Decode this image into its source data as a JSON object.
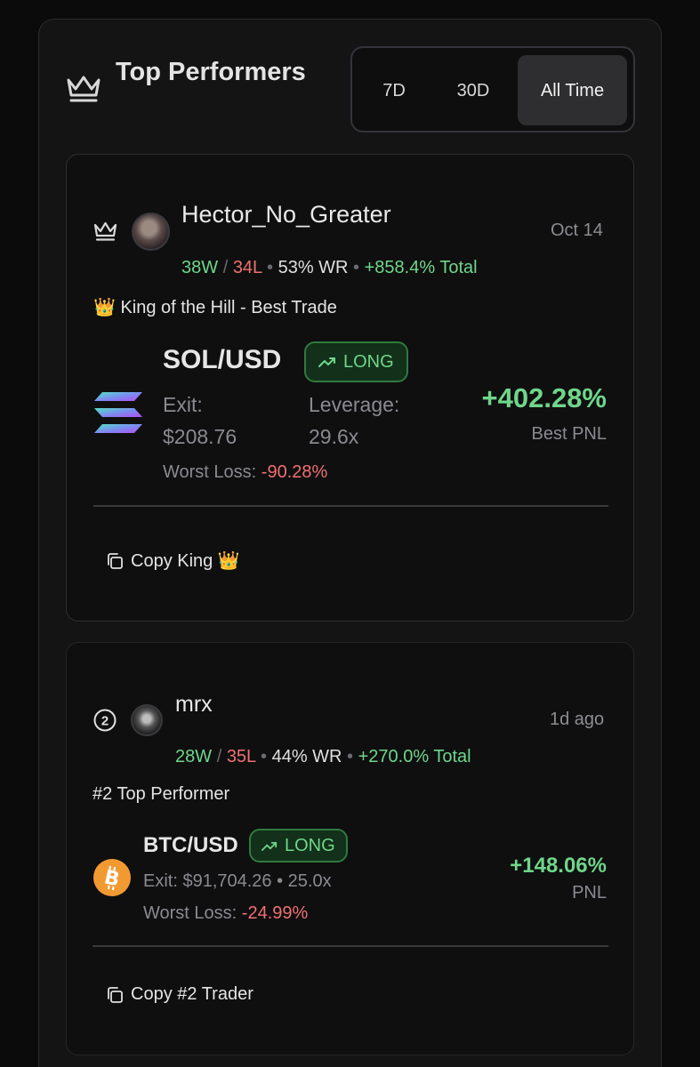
{
  "header": {
    "title": "Top Performers",
    "ranges": [
      "7D",
      "30D",
      "All Time"
    ],
    "selected_range": "All Time"
  },
  "cards": [
    {
      "rank_icon": "crown-icon",
      "name": "Hector_No_Greater",
      "date": "Oct 14",
      "wins": "38W",
      "losses": "34L",
      "win_rate": "53% WR",
      "total": "+858.4% Total",
      "tagline": "👑 King of the Hill - Best Trade",
      "pair": "SOL/USD",
      "side": "LONG",
      "exit_label": "Exit:",
      "exit_value": "$208.76",
      "leverage_label": "Leverage:",
      "leverage_value": "29.6x",
      "worst_loss_label": "Worst Loss:",
      "worst_loss_value": "-90.28%",
      "pnl": "+402.28%",
      "pnl_label": "Best PNL",
      "copy_label": "Copy King 👑"
    },
    {
      "rank_icon": "rank-2-icon",
      "rank_text": "2",
      "name": "mrx",
      "date": "1d ago",
      "wins": "28W",
      "losses": "35L",
      "win_rate": "44% WR",
      "total": "+270.0% Total",
      "tagline": "#2 Top Performer",
      "pair": "BTC/USD",
      "side": "LONG",
      "exit_line": "Exit: $91,704.26 • 25.0x",
      "worst_loss_label": "Worst Loss:",
      "worst_loss_value": "-24.99%",
      "pnl": "+148.06%",
      "pnl_label": "PNL",
      "copy_label": "Copy #2 Trader"
    }
  ],
  "colors": {
    "background": "#0b0b0c",
    "panel": "#141415",
    "green": "#6fd68a",
    "red": "#f07070",
    "muted": "#8a8a90",
    "bitcoin": "#f29a32"
  }
}
